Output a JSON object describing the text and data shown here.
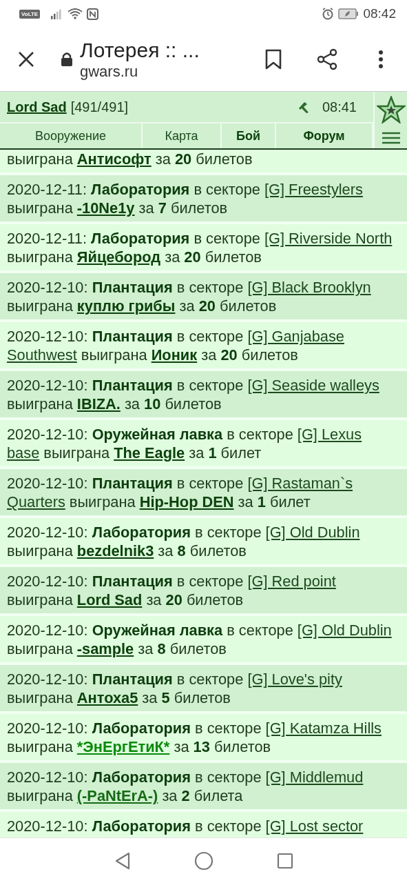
{
  "status_bar": {
    "volte": "VoLTE",
    "time": "08:42"
  },
  "browser": {
    "title": "Лотерея :: ...",
    "domain": "gwars.ru"
  },
  "game_header": {
    "player": "Lord Sad",
    "hp": "[491/491]",
    "time": "08:41",
    "nav": [
      {
        "label": "Вооружение",
        "emphasized": false
      },
      {
        "label": "Карта",
        "emphasized": false
      },
      {
        "label": "Бой",
        "emphasized": true
      },
      {
        "label": "Форум",
        "emphasized": true
      }
    ]
  },
  "entries": [
    {
      "won": "выиграна",
      "winner": "Антисофт",
      "color": "#0d420d",
      "for": "за",
      "count": "20",
      "unit": "билетов"
    },
    {
      "date": "2020-12-11:",
      "place": "Лаборатория",
      "in_sector": "в секторе",
      "sector": [
        "[G] Freestylers"
      ],
      "won": "выиграна",
      "winner": "-10Ne1y",
      "color": "#0d420d",
      "for": "за",
      "count": "7",
      "unit": "билетов"
    },
    {
      "date": "2020-12-11:",
      "place": "Лаборатория",
      "in_sector": "в секторе",
      "sector": [
        "[G] Riverside North"
      ],
      "won": "выиграна",
      "winner": "Яйцебород",
      "color": "#0d420d",
      "for": "за",
      "count": "20",
      "unit": "билетов"
    },
    {
      "date": "2020-12-10:",
      "place": "Плантация",
      "in_sector": "в секторе",
      "sector": [
        "[G] Black Brooklyn"
      ],
      "won": "выиграна",
      "winner": "куплю грибы",
      "color": "#0d420d",
      "for": "за",
      "count": "20",
      "unit": "билетов"
    },
    {
      "date": "2020-12-10:",
      "place": "Плантация",
      "in_sector": "в секторе",
      "sector": [
        "[G] Ganjabase",
        "Southwest"
      ],
      "won": "выиграна",
      "winner": "Ионик",
      "color": "#0d420d",
      "for": "за",
      "count": "20",
      "unit": "билетов"
    },
    {
      "date": "2020-12-10:",
      "place": "Плантация",
      "in_sector": "в секторе",
      "sector": [
        "[G] Seaside walleys"
      ],
      "won": "выиграна",
      "winner": "IBIZA.",
      "color": "#0d420d",
      "for": "за",
      "count": "10",
      "unit": "билетов"
    },
    {
      "date": "2020-12-10:",
      "place": "Оружейная лавка",
      "in_sector": "в секторе",
      "sector": [
        "[G] Lexus",
        "base"
      ],
      "won": "выиграна",
      "winner": "The Eagle",
      "color": "#0d420d",
      "for": "за",
      "count": "1",
      "unit": "билет"
    },
    {
      "date": "2020-12-10:",
      "place": "Плантация",
      "in_sector": "в секторе",
      "sector": [
        "[G] Rastaman`s",
        "Quarters"
      ],
      "won": "выиграна",
      "winner": "Hip-Hop DEN",
      "color": "#0d420d",
      "for": "за",
      "count": "1",
      "unit": "билет"
    },
    {
      "date": "2020-12-10:",
      "place": "Лаборатория",
      "in_sector": "в секторе",
      "sector": [
        "[G] Old Dublin"
      ],
      "won": "выиграна",
      "winner": "bezdelnik3",
      "color": "#0d420d",
      "for": "за",
      "count": "8",
      "unit": "билетов"
    },
    {
      "date": "2020-12-10:",
      "place": "Плантация",
      "in_sector": "в секторе",
      "sector": [
        "[G] Red point"
      ],
      "won": "выиграна",
      "winner": "Lord Sad",
      "color": "#0d420d",
      "for": "за",
      "count": "20",
      "unit": "билетов"
    },
    {
      "date": "2020-12-10:",
      "place": "Оружейная лавка",
      "in_sector": "в секторе",
      "sector": [
        "[G] Old Dublin"
      ],
      "won": "выиграна",
      "winner": "-sample",
      "color": "#0d420d",
      "for": "за",
      "count": "8",
      "unit": "билетов"
    },
    {
      "date": "2020-12-10:",
      "place": "Плантация",
      "in_sector": "в секторе",
      "sector": [
        "[G] Love's pity"
      ],
      "won": "выиграна",
      "winner": "Антоха5",
      "color": "#0d420d",
      "for": "за",
      "count": "5",
      "unit": "билетов"
    },
    {
      "date": "2020-12-10:",
      "place": "Лаборатория",
      "in_sector": "в секторе",
      "sector": [
        "[G] Katamza Hills"
      ],
      "won": "выиграна",
      "winner": "*ЭнЕргЕтиК*",
      "color": "#0a8a0a",
      "for": "за",
      "count": "13",
      "unit": "билетов"
    },
    {
      "date": "2020-12-10:",
      "place": "Лаборатория",
      "in_sector": "в секторе",
      "sector": [
        "[G] Middlemud"
      ],
      "won": "выиграна",
      "winner": "(-PaNtErA-)",
      "color": "#166b16",
      "for": "за",
      "count": "2",
      "unit": "билета"
    },
    {
      "date": "2020-12-10:",
      "place": "Лаборатория",
      "in_sector": "в секторе",
      "sector": [
        "[G] Lost sector"
      ]
    }
  ]
}
